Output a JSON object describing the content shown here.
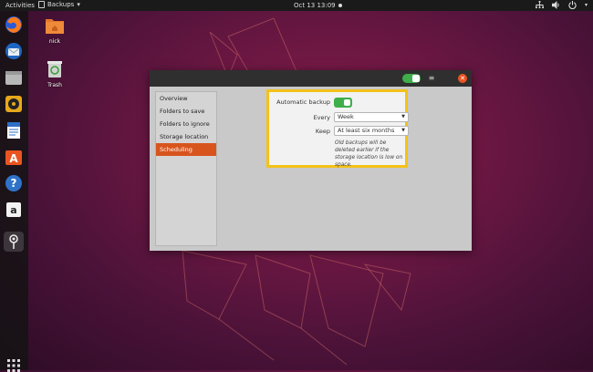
{
  "topbar": {
    "activities": "Activities",
    "app_menu": "Backups",
    "app_menu_icon": "backups-app-icon",
    "clock": "Oct 13  13:09",
    "tray_icons": [
      "network-icon",
      "volume-icon",
      "power-icon"
    ]
  },
  "dock": {
    "items": [
      "firefox-icon",
      "thunderbird-icon",
      "files-icon",
      "rhythmbox-icon",
      "writer-icon",
      "software-icon",
      "help-icon",
      "amazon-icon",
      "backups-icon"
    ],
    "show_apps_icon": "app-grid-icon"
  },
  "desktop": {
    "icons": [
      {
        "label": "nick",
        "icon": "home-folder-icon"
      },
      {
        "label": "Trash",
        "icon": "trash-icon"
      }
    ]
  },
  "window": {
    "sidebar": {
      "items": [
        "Overview",
        "Folders to save",
        "Folders to ignore",
        "Storage location",
        "Scheduling"
      ],
      "selected": "Scheduling"
    },
    "scheduling": {
      "automatic_backup_label": "Automatic backup",
      "automatic_backup_on": true,
      "every_label": "Every",
      "every_value": "Week",
      "keep_label": "Keep",
      "keep_value": "At least six months",
      "note": "Old backups will be deleted earlier if the storage location is low on space."
    }
  },
  "colors": {
    "accent": "#e95420",
    "toggle": "#3fae4a",
    "highlight": "#f3c21a",
    "selected_item": "#d8541d"
  }
}
